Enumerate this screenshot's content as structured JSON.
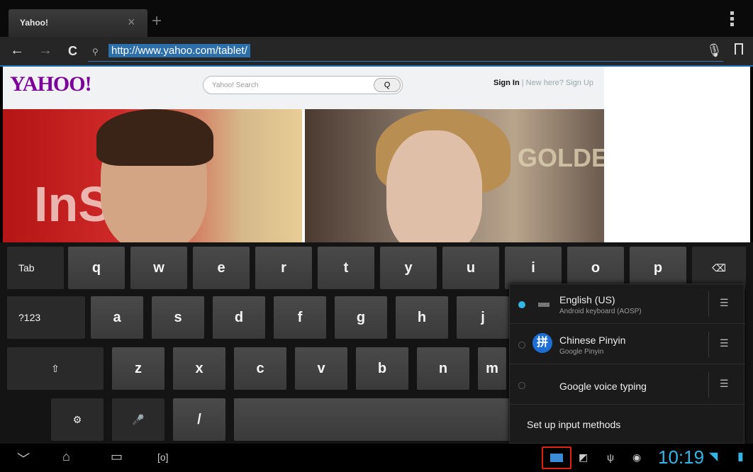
{
  "tab": {
    "title": "Yahoo!",
    "close": "×",
    "new": "+"
  },
  "urlbar": {
    "back": "←",
    "forward": "→",
    "reload": "C",
    "url": "http://www.yahoo.com/tablet/"
  },
  "page": {
    "logo": "YAHOO!",
    "search_placeholder": "Yahoo! Search",
    "search_button": "Q",
    "signin": "Sign In",
    "separator": "|",
    "signup": "New here? Sign Up",
    "photo1_text": "InStyle",
    "photo2_text": "GOLDE"
  },
  "keyboard": {
    "row1": [
      "Tab",
      "q",
      "w",
      "e",
      "r",
      "t",
      "y",
      "u",
      "i",
      "o",
      "p",
      "⌫"
    ],
    "row2": [
      "?123",
      "a",
      "s",
      "d",
      "f",
      "g",
      "h",
      "j"
    ],
    "row3": [
      "⇧",
      "z",
      "x",
      "c",
      "v",
      "b",
      "n",
      "m"
    ],
    "row4": [
      "⚙",
      "🎤",
      "/",
      ""
    ]
  },
  "input_methods": {
    "items": [
      {
        "name": "English (US)",
        "sub": "Android keyboard (AOSP)",
        "selected": true
      },
      {
        "name": "Chinese Pinyin",
        "sub": "Google Pinyin",
        "selected": false,
        "badge": "拼"
      },
      {
        "name": "Google voice typing",
        "sub": "",
        "selected": false
      }
    ],
    "setup": "Set up input methods"
  },
  "status": {
    "time": "10:19",
    "accent": "#33b5e5"
  }
}
